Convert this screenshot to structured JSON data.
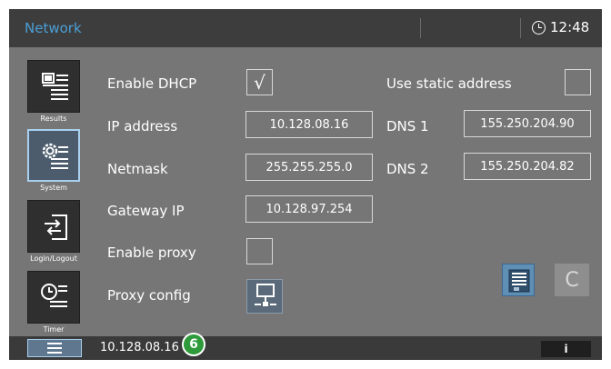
{
  "header": {
    "title": "Network",
    "time": "12:48"
  },
  "sidebar": {
    "items": [
      {
        "caption": "Results",
        "icon": "results-icon",
        "active": false
      },
      {
        "caption": "System",
        "icon": "system-gear-icon",
        "active": true
      },
      {
        "caption": "Login/Logout",
        "icon": "login-logout-icon",
        "active": false
      },
      {
        "caption": "Timer",
        "icon": "timer-clock-icon",
        "active": false
      }
    ]
  },
  "form": {
    "enable_dhcp": {
      "label": "Enable DHCP",
      "checked": true,
      "mark": "√"
    },
    "use_static": {
      "label": "Use static address",
      "checked": false
    },
    "ip": {
      "label": "IP address",
      "value": "10.128.08.16"
    },
    "netmask": {
      "label": "Netmask",
      "value": "255.255.255.0"
    },
    "gateway": {
      "label": "Gateway IP",
      "value": "10.128.97.254"
    },
    "dns1": {
      "label": "DNS 1",
      "value": "155.250.204.90"
    },
    "dns2": {
      "label": "DNS 2",
      "value": "155.250.204.82"
    },
    "enable_proxy": {
      "label": "Enable proxy",
      "checked": false
    },
    "proxy_config": {
      "label": "Proxy config",
      "icon": "network-computer-icon"
    }
  },
  "actions": {
    "save_icon": "save-icon",
    "cancel_label": "C"
  },
  "footer": {
    "ip": "10.128.08.16",
    "badge": "6",
    "info_label": "i"
  },
  "colors": {
    "accent": "#4a9fd8",
    "badge": "#2e9a3a",
    "save": "#5f8fb5"
  }
}
